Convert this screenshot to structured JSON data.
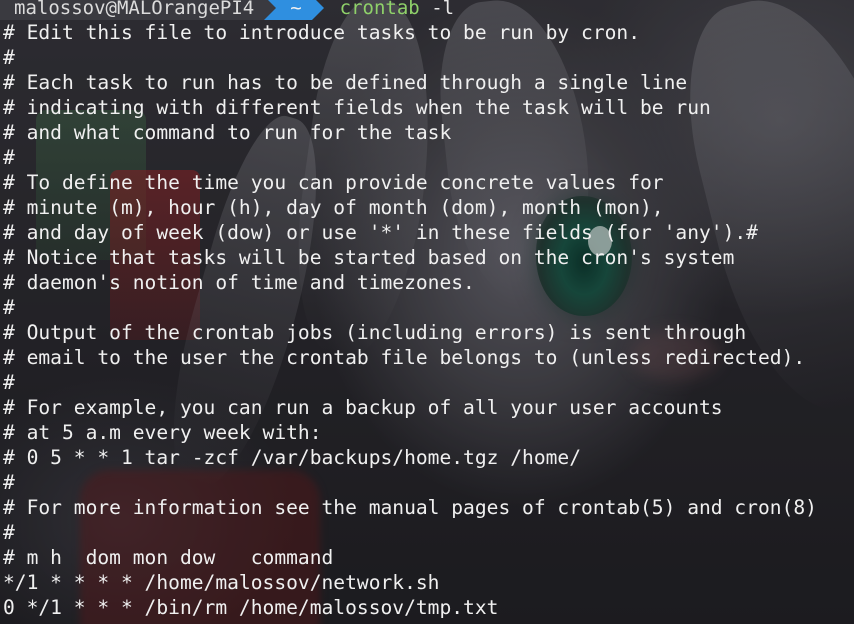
{
  "prompt": {
    "user_host": "malossov@MALOrangePI4",
    "directory": "~",
    "command": "crontab",
    "argument": "-l"
  },
  "colors": {
    "user_segment_bg": "#3a3a40",
    "directory_segment_bg": "#2f8fe0",
    "command_text": "#8fd16a",
    "output_text": "#f0f0f0"
  },
  "output_lines": [
    "# Edit this file to introduce tasks to be run by cron.",
    "#",
    "# Each task to run has to be defined through a single line",
    "# indicating with different fields when the task will be run",
    "# and what command to run for the task",
    "#",
    "# To define the time you can provide concrete values for",
    "# minute (m), hour (h), day of month (dom), month (mon),",
    "# and day of week (dow) or use '*' in these fields (for 'any').#",
    "# Notice that tasks will be started based on the cron's system",
    "# daemon's notion of time and timezones.",
    "#",
    "# Output of the crontab jobs (including errors) is sent through",
    "# email to the user the crontab file belongs to (unless redirected).",
    "#",
    "# For example, you can run a backup of all your user accounts",
    "# at 5 a.m every week with:",
    "# 0 5 * * 1 tar -zcf /var/backups/home.tgz /home/",
    "#",
    "# For more information see the manual pages of crontab(5) and cron(8)",
    "#",
    "# m h  dom mon dow   command",
    "*/1 * * * * /home/malossov/network.sh",
    "0 */1 * * * /bin/rm /home/malossov/tmp.txt"
  ]
}
